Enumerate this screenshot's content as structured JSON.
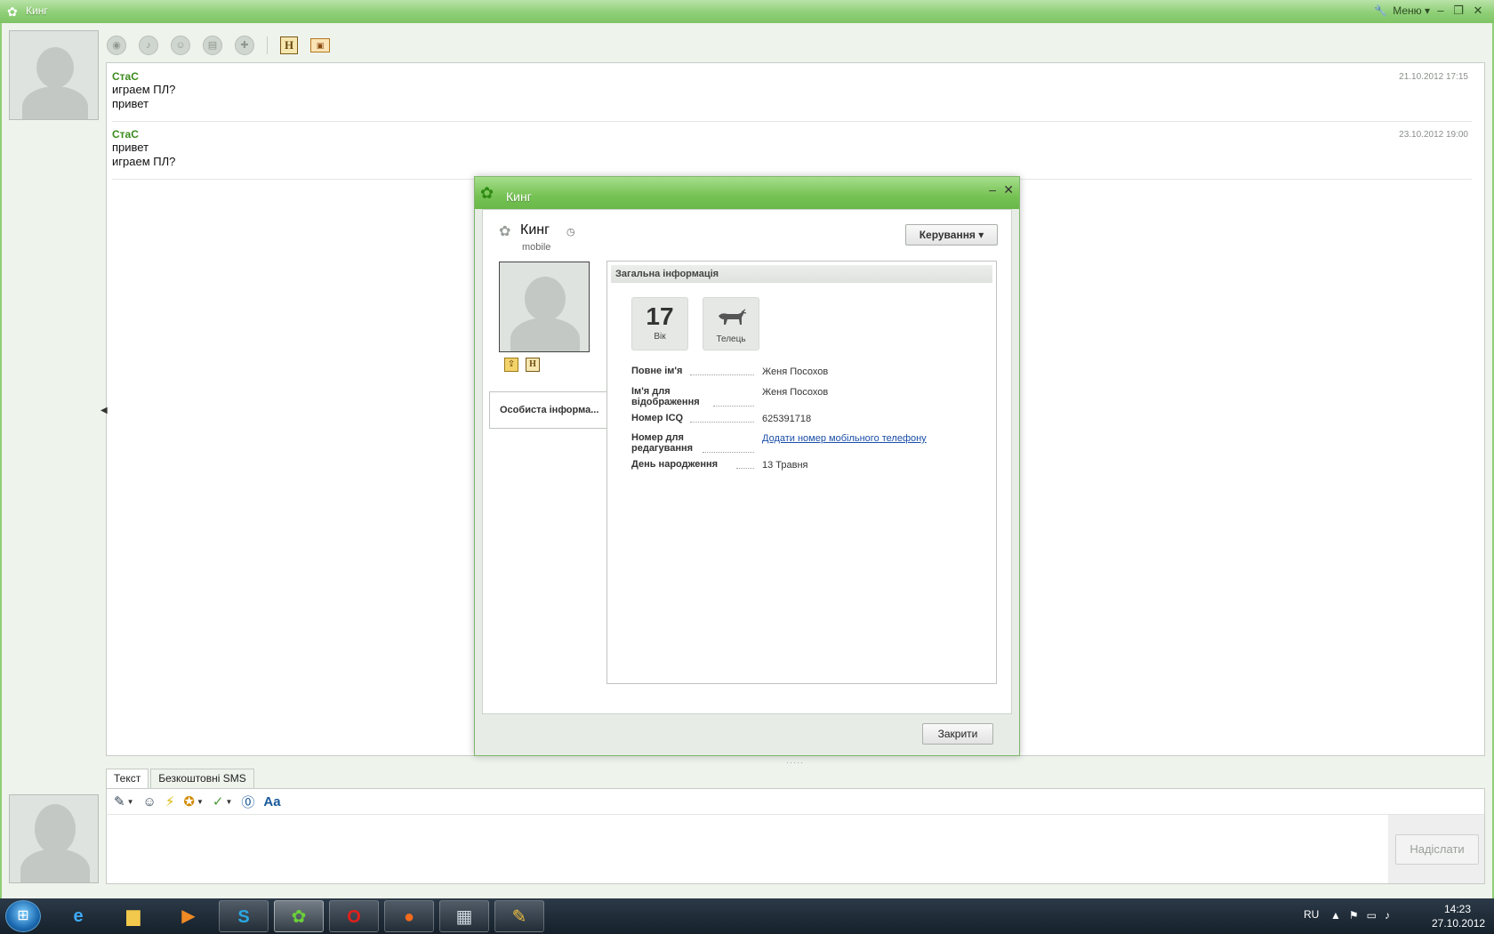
{
  "window": {
    "title": "Кинг",
    "menu_label": "Меню",
    "min_glyph": "–",
    "max_glyph": "❐",
    "close_glyph": "✕"
  },
  "toolbar_icons": [
    "webcam-icon",
    "microphone-icon",
    "contacts-icon",
    "files-icon",
    "games-icon",
    "notes-h-icon",
    "contact-card-icon"
  ],
  "messages": [
    {
      "author": "СтаС",
      "timestamp": "21.10.2012 17:15",
      "lines": [
        "играем ПЛ?",
        "привет"
      ]
    },
    {
      "author": "СтаС",
      "timestamp": "23.10.2012 19:00",
      "lines": [
        "привет",
        "играем ПЛ?"
      ]
    }
  ],
  "composer": {
    "tabs": [
      "Текст",
      "Безкоштовні SMS"
    ],
    "send_label": "Надіслати"
  },
  "dialog": {
    "title": "Кинг",
    "contact_name": "Кинг",
    "contact_status": "mobile",
    "manage_label": "Керування",
    "side_tab_label": "Особиста інформа...",
    "section_title": "Загальна інформація",
    "age_value": "17",
    "age_label": "Вік",
    "zodiac_label": "Телець",
    "fields": [
      {
        "label": "Повне ім'я",
        "value": "Женя Посохов"
      },
      {
        "label": "Ім'я для відображення",
        "value": "Женя Посохов"
      },
      {
        "label": "Номер ICQ",
        "value": "625391718"
      },
      {
        "label": "Номер для редагування",
        "value": "Додати номер мобільного телефону"
      },
      {
        "label": "День народження",
        "value": "13 Травня"
      }
    ],
    "close_label": "Закрити"
  },
  "taskbar": {
    "apps": [
      "internet-explorer",
      "file-explorer",
      "media-player",
      "skype",
      "icq",
      "opera",
      "origin",
      "calculator",
      "paint"
    ],
    "lang": "RU",
    "time": "14:23",
    "date": "27.10.2012"
  },
  "colors": {
    "accent_green": "#7fc465",
    "author_green": "#3c8c1e",
    "link_blue": "#1a4ea8"
  }
}
